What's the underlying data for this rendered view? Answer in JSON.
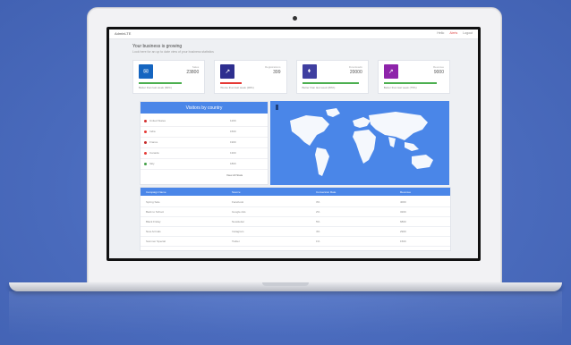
{
  "app": {
    "brand": "AdminLTE",
    "top_actions": [
      "Hello",
      "Alerts",
      "Logout"
    ],
    "page_title": "Your business is growing",
    "page_subtitle": "Look here for an up to date view of your business statistics"
  },
  "cards": [
    {
      "title": "Sales",
      "value": "23800",
      "footer": "Better than last week (60%)",
      "color": "#1565c0",
      "bar_color": "#4caf50",
      "icon": "mail-icon",
      "glyph": "✉"
    },
    {
      "title": "Registrations",
      "value": "399",
      "footer": "Worse than last week (30%)",
      "color": "#2e2f8f",
      "bar_color": "#e53935",
      "icon": "chart-icon",
      "glyph": "↗"
    },
    {
      "title": "Downloads",
      "value": "20000",
      "footer": "Better than last week (80%)",
      "color": "#3f3fa0",
      "bar_color": "#4caf50",
      "icon": "tag-icon",
      "glyph": "⬧"
    },
    {
      "title": "Revenue",
      "value": "9000",
      "footer": "Better than last week (75%)",
      "color": "#8e24aa",
      "bar_color": "#4caf50",
      "icon": "trend-icon",
      "glyph": "↗"
    }
  ],
  "visitors": {
    "header": "Visitors by country",
    "countries": [
      {
        "name": "United States",
        "value": "1200",
        "flag": "#d32f2f"
      },
      {
        "name": "India",
        "value": "1500",
        "flag": "#e53935"
      },
      {
        "name": "France",
        "value": "1900",
        "flag": "#c62828"
      },
      {
        "name": "Canada",
        "value": "1300",
        "flag": "#e53935"
      },
      {
        "name": "Italy",
        "value": "1800",
        "flag": "#43a047"
      }
    ],
    "view_all": "View All Stats"
  },
  "table": {
    "headers": [
      "Campaign Name",
      "Source",
      "Conversion Rate",
      "Revenue"
    ],
    "rows": [
      [
        "Spring Sale",
        "Facebook",
        "3%",
        "4000"
      ],
      [
        "Back to School",
        "Google Ads",
        "2%",
        "3200"
      ],
      [
        "Black Friday",
        "Newsletter",
        "5%",
        "6800"
      ],
      [
        "New Arrivals",
        "Instagram",
        "4%",
        "2900"
      ],
      [
        "Summer Special",
        "Twitter",
        "1%",
        "1500"
      ]
    ]
  }
}
